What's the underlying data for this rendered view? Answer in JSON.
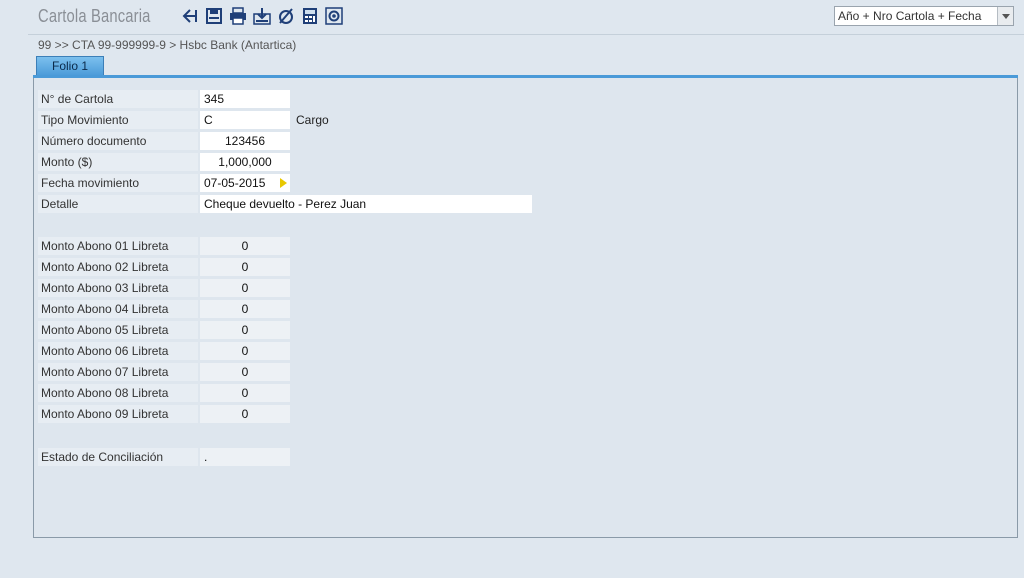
{
  "app": {
    "title": "Cartola Bancaria"
  },
  "toolbar": {
    "icons": [
      "back-icon",
      "save-icon",
      "print-icon",
      "export-icon",
      "clear-icon",
      "calculator-icon",
      "settings-icon"
    ]
  },
  "sort": {
    "selected": "Año + Nro Cartola + Fecha"
  },
  "breadcrumb": "99 >> CTA 99-999999-9 > Hsbc Bank  (Antartica)",
  "tabs": [
    {
      "label": "Folio 1"
    }
  ],
  "form": {
    "cartola": {
      "label": "N° de Cartola",
      "value": "345"
    },
    "tipo": {
      "label": "Tipo Movimiento",
      "value": "C",
      "description": "Cargo"
    },
    "documento": {
      "label": "Número documento",
      "value": "123456"
    },
    "monto": {
      "label": "Monto ($)",
      "value": "1,000,000"
    },
    "fecha": {
      "label": "Fecha movimiento",
      "value": "07-05-2015"
    },
    "detalle": {
      "label": "Detalle",
      "value": "Cheque devuelto - Perez Juan"
    },
    "abonos": [
      {
        "label": "Monto Abono 01 Libreta",
        "value": "0"
      },
      {
        "label": "Monto Abono 02 Libreta",
        "value": "0"
      },
      {
        "label": "Monto Abono 03 Libreta",
        "value": "0"
      },
      {
        "label": "Monto Abono 04 Libreta",
        "value": "0"
      },
      {
        "label": "Monto Abono 05 Libreta",
        "value": "0"
      },
      {
        "label": "Monto Abono 06 Libreta",
        "value": "0"
      },
      {
        "label": "Monto Abono 07 Libreta",
        "value": "0"
      },
      {
        "label": "Monto Abono 08 Libreta",
        "value": "0"
      },
      {
        "label": "Monto Abono 09 Libreta",
        "value": "0"
      }
    ],
    "estado": {
      "label": "Estado de Conciliación",
      "value": "."
    }
  },
  "colors": {
    "accent": "#4a9ad8",
    "icon": "#1f3f78",
    "date_arrow": "#e8c800"
  }
}
